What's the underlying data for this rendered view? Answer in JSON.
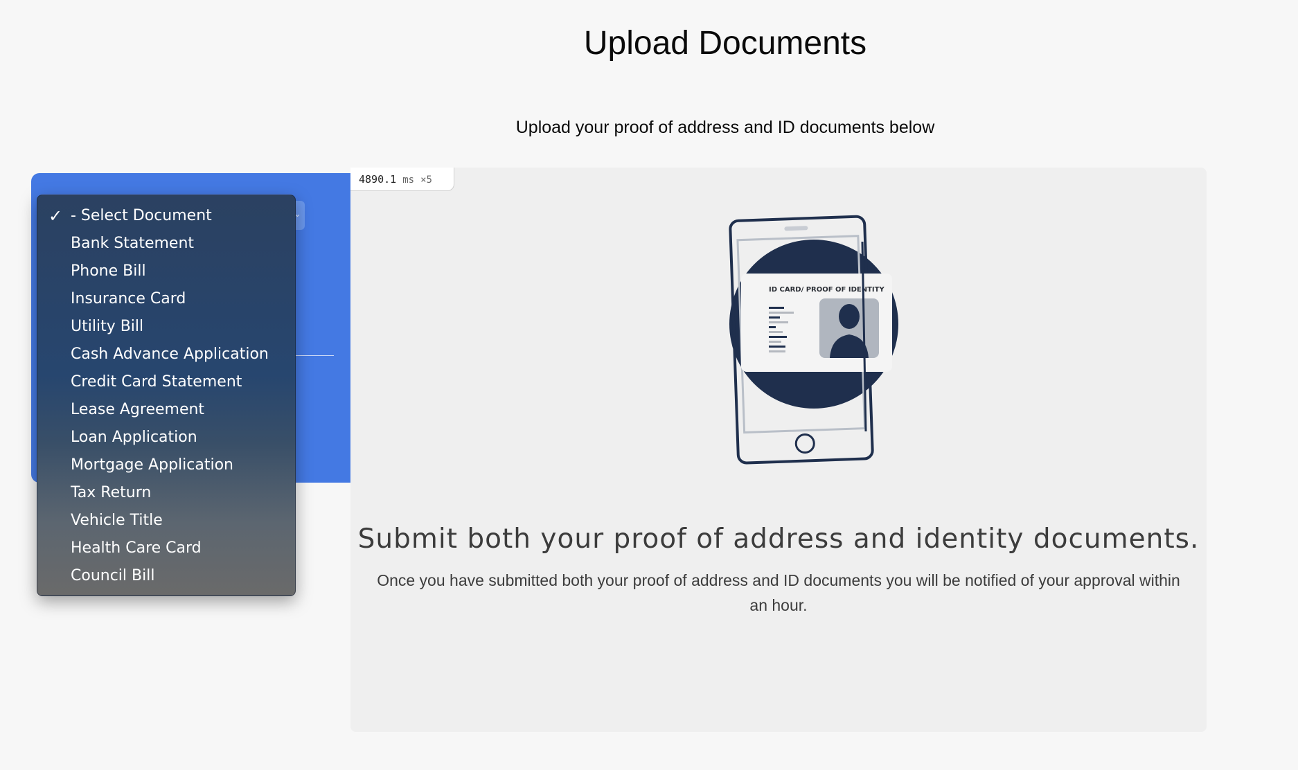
{
  "page": {
    "title": "Upload Documents",
    "subtitle": "Upload your proof of address and ID documents below"
  },
  "timing_badge": {
    "value": "4890.1",
    "unit": "ms",
    "multiplier": "×5"
  },
  "illustration": {
    "card_title": "ID CARD/ PROOF OF IDENTITY",
    "icon": "id-card-phone-illustration"
  },
  "main": {
    "heading": "Submit both your proof of address and identity documents.",
    "text": "Once you have submitted both your proof of address and ID documents you will be notified of your approval within an hour."
  },
  "document_select": {
    "selected": "- Select Document",
    "options": [
      {
        "label": "- Select Document",
        "checked": true
      },
      {
        "label": "Bank Statement"
      },
      {
        "label": "Phone Bill"
      },
      {
        "label": "Insurance Card"
      },
      {
        "label": "Utility Bill"
      },
      {
        "label": "Cash Advance Application"
      },
      {
        "label": "Credit Card Statement"
      },
      {
        "label": "Lease Agreement"
      },
      {
        "label": "Loan Application"
      },
      {
        "label": "Mortgage Application"
      },
      {
        "label": "Tax Return"
      },
      {
        "label": "Vehicle Title"
      },
      {
        "label": "Health Care Card"
      },
      {
        "label": "Council Bill"
      }
    ]
  },
  "colors": {
    "background": "#f7f7f7",
    "panel_blue": "#4479e3",
    "panel_gray": "#efefef",
    "illustration_navy": "#1f2f4d",
    "text_dark": "#3c3c3c"
  }
}
